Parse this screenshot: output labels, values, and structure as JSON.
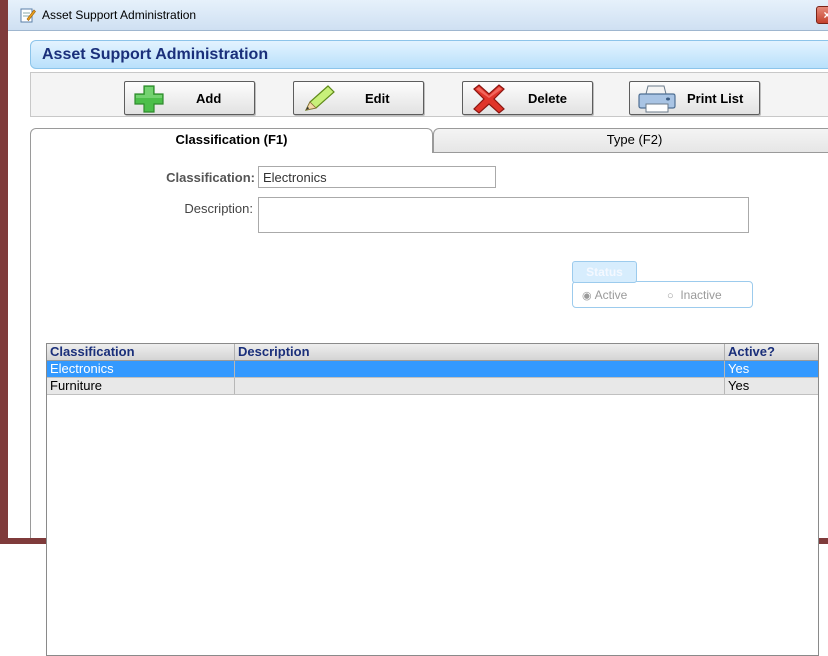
{
  "window": {
    "title": "Asset Support Administration",
    "close_label": "×"
  },
  "header": {
    "title": "Asset Support Administration"
  },
  "toolbar": {
    "add_label": "Add",
    "edit_label": "Edit",
    "delete_label": "Delete",
    "print_label": "Print List",
    "icons": {
      "add": "plus-icon",
      "edit": "pencil-icon",
      "delete": "x-icon",
      "print": "printer-icon"
    }
  },
  "tabs": [
    {
      "label": "Classification (F1)",
      "active": true
    },
    {
      "label": "Type (F2)",
      "active": false
    }
  ],
  "form": {
    "classification_label": "Classification:",
    "classification_value": "Electronics",
    "description_label": "Description:",
    "description_value": "",
    "status": {
      "title": "Status",
      "options": [
        {
          "label": "Active",
          "selected": true
        },
        {
          "label": "Inactive",
          "selected": false
        }
      ]
    }
  },
  "table": {
    "columns": [
      "Classification",
      "Description",
      "Active?"
    ],
    "rows": [
      {
        "classification": "Electronics",
        "description": "",
        "active": "Yes",
        "selected": true
      },
      {
        "classification": "Furniture",
        "description": "",
        "active": "Yes",
        "selected": false
      }
    ]
  },
  "colors": {
    "accent": "#3399ff",
    "header_text": "#1a2f7a",
    "frame": "#7f3b3b"
  }
}
